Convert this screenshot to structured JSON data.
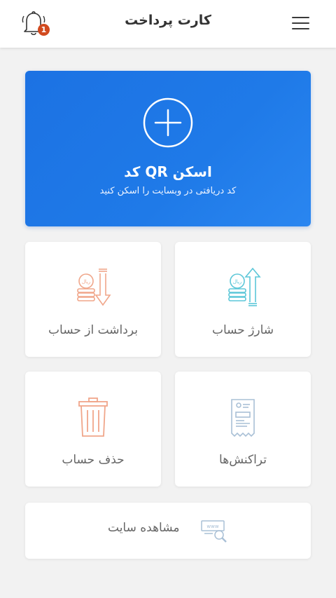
{
  "header": {
    "title": "کارت پرداخت",
    "notification_count": "1",
    "menu_icon": "hamburger-menu-icon",
    "bell_icon": "bell-icon"
  },
  "scan": {
    "title": "اسکن QR کد",
    "subtitle": "کد دریافتی در وبسایت را اسکن کنید",
    "icon": "plus-circle-icon",
    "color": "#1f77e6"
  },
  "tiles": [
    {
      "label": "شارژ حساب",
      "icon": "coins-arrow-up-icon",
      "coin_text": "ریال",
      "color": "#5cc7d8"
    },
    {
      "label": "برداشت از حساب",
      "icon": "coins-arrow-down-icon",
      "coin_text": "ریال",
      "color": "#f0a68a"
    },
    {
      "label": "تراکنش‌ها",
      "icon": "receipt-icon",
      "color": "#a9c0d6"
    },
    {
      "label": "حذف حساب",
      "icon": "trash-icon",
      "color": "#f0a68a"
    }
  ],
  "site": {
    "label": "مشاهده سایت",
    "icon": "www-search-icon",
    "icon_text": "www"
  }
}
